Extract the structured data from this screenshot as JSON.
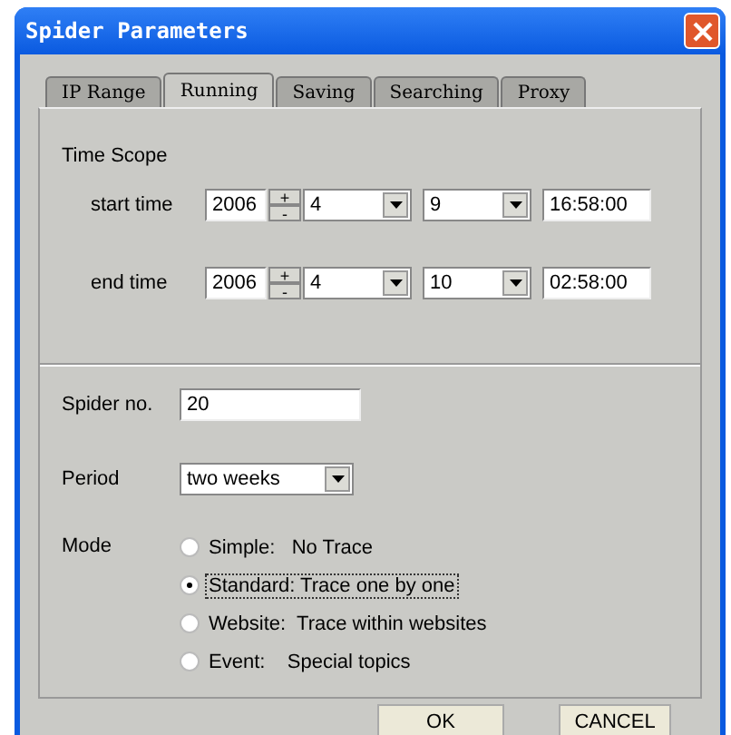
{
  "window": {
    "title": "Spider Parameters"
  },
  "tabs": [
    {
      "label": "IP Range",
      "selected": false
    },
    {
      "label": "Running",
      "selected": true
    },
    {
      "label": "Saving",
      "selected": false
    },
    {
      "label": "Searching",
      "selected": false
    },
    {
      "label": "Proxy",
      "selected": false
    }
  ],
  "time_scope": {
    "label": "Time Scope",
    "rows": [
      {
        "label": "start time",
        "year": "2006",
        "up": "+",
        "down": "-",
        "month": "4",
        "day": "9",
        "time": "16:58:00"
      },
      {
        "label": "end time",
        "year": "2006",
        "up": "+",
        "down": "-",
        "month": "4",
        "day": "10",
        "time": "02:58:00"
      }
    ]
  },
  "spider_no": {
    "label": "Spider no.",
    "value": "20"
  },
  "period": {
    "label": "Period",
    "value": "two weeks"
  },
  "mode": {
    "label": "Mode",
    "options": [
      {
        "label": "Simple:   No Trace",
        "selected": false
      },
      {
        "label": "Standard: Trace one by one",
        "selected": true
      },
      {
        "label": "Website:  Trace within websites",
        "selected": false
      },
      {
        "label": "Event:    Special topics",
        "selected": false
      }
    ]
  },
  "buttons": [
    "OK",
    "CANCEL"
  ]
}
